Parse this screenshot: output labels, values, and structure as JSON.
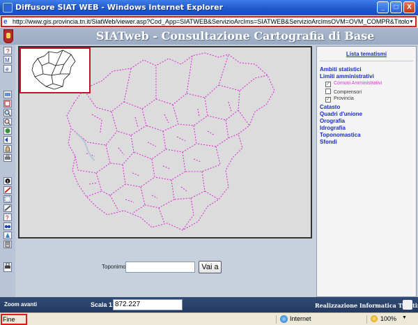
{
  "window": {
    "title": "Diffusore SIAT WEB - Windows Internet Explorer",
    "minimize": "_",
    "maximize": "□",
    "close": "X"
  },
  "address": {
    "url": "http://www.gis.provincia.tn.it/SiatWeb/viewer.asp?Cod_App=SIATWEB&ServizioArcIms=SIATWEB&ServizioArcImsOVM=OVM_COMPR&Titolo=Diffusore SIAT W"
  },
  "page": {
    "title": "SIATweb - Consultazione Cartografia di Base"
  },
  "toolbar": {
    "icons": [
      "help-icon",
      "mail-icon",
      "info-page-icon",
      "layers-icon",
      "zoom-window-icon",
      "zoom-in-icon",
      "zoom-out-icon",
      "full-extent-icon",
      "back-icon",
      "pan-icon",
      "print-icon",
      "identify-icon",
      "measure-icon",
      "select-icon",
      "clear-icon",
      "find-icon",
      "binoculars-icon",
      "locate-icon",
      "query-icon",
      "print-map-icon"
    ]
  },
  "map": {
    "boundary_color": "#d633d6",
    "overview_border": "#c8102e"
  },
  "search": {
    "label": "Toponimo:",
    "value": "",
    "button": "Vai a"
  },
  "legend": {
    "title": "Lista tematismi",
    "categories": [
      "Ambiti statistici",
      "Limiti amministrativi",
      "Catasto",
      "Quadri d'unione",
      "Orografia",
      "Idrografia",
      "Toponomastica",
      "Sfondi"
    ],
    "layers": [
      {
        "label": "Comuni Amministrativi",
        "checked": true
      },
      {
        "label": "Comprensori",
        "checked": false
      },
      {
        "label": "Provincia",
        "checked": true
      }
    ]
  },
  "bottom": {
    "mode": "Zoom avanti",
    "scale_label": "Scala 1:",
    "scale_value": "872.227",
    "credit": "Realizzazione Informatica Trentina"
  },
  "status": {
    "text": "Fine",
    "zone": "Internet",
    "zoom": "100%"
  }
}
